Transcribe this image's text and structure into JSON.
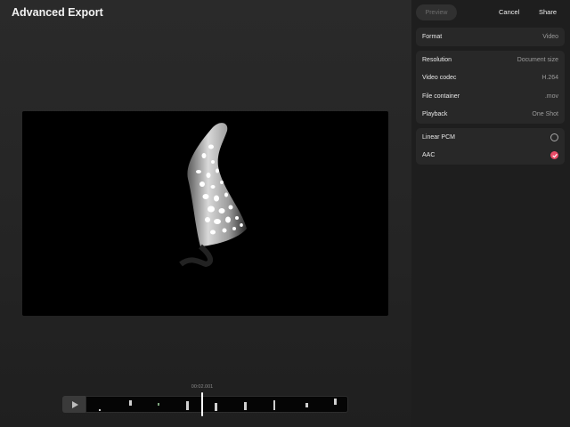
{
  "header": {
    "title": "Advanced Export"
  },
  "timeline": {
    "timecode": "00:02.001"
  },
  "toolbar": {
    "preview_label": "Preview",
    "cancel_label": "Cancel",
    "share_label": "Share"
  },
  "settings": {
    "format": {
      "label": "Format",
      "value": "Video"
    },
    "resolution": {
      "label": "Resolution",
      "value": "Document size"
    },
    "video_codec": {
      "label": "Video codec",
      "value": "H.264"
    },
    "file_container": {
      "label": "File container",
      "value": ".mov"
    },
    "playback": {
      "label": "Playback",
      "value": "One Shot"
    }
  },
  "audio": {
    "options": [
      {
        "label": "Linear PCM",
        "selected": false
      },
      {
        "label": "AAC",
        "selected": true
      }
    ]
  },
  "colors": {
    "accent": "#e94b67",
    "panel_bg": "#1e1e1e",
    "group_bg": "#282828"
  }
}
